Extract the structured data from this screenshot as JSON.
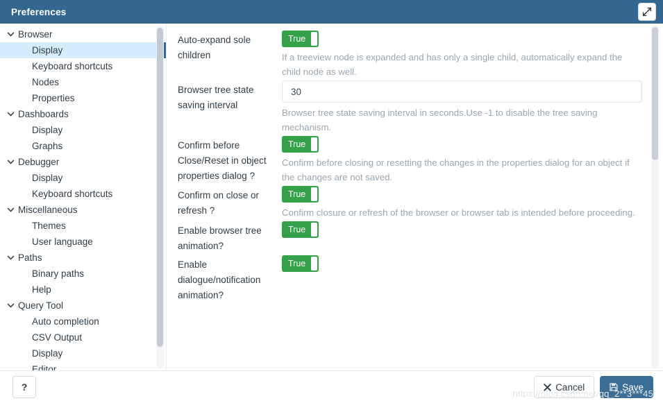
{
  "window": {
    "title": "Preferences",
    "expand_icon": "expand-arrows-icon"
  },
  "sidebar": {
    "items": [
      {
        "label": "Browser",
        "type": "group",
        "expanded": true,
        "selected": false
      },
      {
        "label": "Display",
        "type": "child",
        "expanded": false,
        "selected": true
      },
      {
        "label": "Keyboard shortcuts",
        "type": "child",
        "expanded": false,
        "selected": false
      },
      {
        "label": "Nodes",
        "type": "child",
        "expanded": false,
        "selected": false
      },
      {
        "label": "Properties",
        "type": "child",
        "expanded": false,
        "selected": false
      },
      {
        "label": "Dashboards",
        "type": "group",
        "expanded": true,
        "selected": false
      },
      {
        "label": "Display",
        "type": "child",
        "expanded": false,
        "selected": false
      },
      {
        "label": "Graphs",
        "type": "child",
        "expanded": false,
        "selected": false
      },
      {
        "label": "Debugger",
        "type": "group",
        "expanded": true,
        "selected": false
      },
      {
        "label": "Display",
        "type": "child",
        "expanded": false,
        "selected": false
      },
      {
        "label": "Keyboard shortcuts",
        "type": "child",
        "expanded": false,
        "selected": false
      },
      {
        "label": "Miscellaneous",
        "type": "group",
        "expanded": true,
        "selected": false
      },
      {
        "label": "Themes",
        "type": "child",
        "expanded": false,
        "selected": false
      },
      {
        "label": "User language",
        "type": "child",
        "expanded": false,
        "selected": false
      },
      {
        "label": "Paths",
        "type": "group",
        "expanded": true,
        "selected": false
      },
      {
        "label": "Binary paths",
        "type": "child",
        "expanded": false,
        "selected": false
      },
      {
        "label": "Help",
        "type": "child",
        "expanded": false,
        "selected": false
      },
      {
        "label": "Query Tool",
        "type": "group",
        "expanded": true,
        "selected": false
      },
      {
        "label": "Auto completion",
        "type": "child",
        "expanded": false,
        "selected": false
      },
      {
        "label": "CSV Output",
        "type": "child",
        "expanded": false,
        "selected": false
      },
      {
        "label": "Display",
        "type": "child",
        "expanded": false,
        "selected": false
      },
      {
        "label": "Editor",
        "type": "child",
        "expanded": false,
        "selected": false
      }
    ]
  },
  "settings": [
    {
      "label": "Auto-expand sole children",
      "control": "toggle",
      "value": "True",
      "help": "If a treeview node is expanded and has only a single child, automatically expand the child node as well."
    },
    {
      "label": "Browser tree state saving interval",
      "control": "input",
      "value": "30",
      "help": "Browser tree state saving interval in seconds.Use -1 to disable the tree saving mechanism."
    },
    {
      "label": "Confirm before Close/Reset in object properties dialog ?",
      "control": "toggle",
      "value": "True",
      "help": "Confirm before closing or resetting the changes in the properties dialog for an object if the changes are not saved."
    },
    {
      "label": "Confirm on close or refresh ?",
      "control": "toggle",
      "value": "True",
      "help": "Confirm closure or refresh of the browser or browser tab is intended before proceeding."
    },
    {
      "label": "Enable browser tree animation?",
      "control": "toggle",
      "value": "True",
      "help": ""
    },
    {
      "label": "Enable dialogue/notification animation?",
      "control": "toggle",
      "value": "True",
      "help": ""
    }
  ],
  "footer": {
    "help_label": "?",
    "cancel_label": "Cancel",
    "save_label": "Save",
    "cancel_icon": "close-x-icon",
    "save_icon": "floppy-disk-icon",
    "watermark": "https://blog.csdn.net/qq_2**3***45"
  },
  "colors": {
    "titlebar": "#336791",
    "toggle_on": "#35a04a",
    "selected_row": "#d4ecfb",
    "selected_marker": "#336791",
    "save_button": "#3a6e97",
    "help_text": "#9aa6b2"
  }
}
